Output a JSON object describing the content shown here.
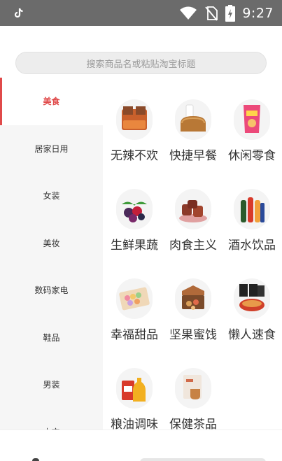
{
  "status_bar": {
    "time": "9:27",
    "app_icon": "tiktok-icon",
    "icons": [
      "wifi-icon",
      "no-sim-icon",
      "battery-charging-icon"
    ]
  },
  "search": {
    "placeholder": "搜索商品名或粘贴淘宝标题"
  },
  "sidebar": {
    "items": [
      {
        "label": "美食",
        "active": true
      },
      {
        "label": "居家日用",
        "active": false
      },
      {
        "label": "女装",
        "active": false
      },
      {
        "label": "美妆",
        "active": false
      },
      {
        "label": "数码家电",
        "active": false
      },
      {
        "label": "鞋品",
        "active": false
      },
      {
        "label": "男装",
        "active": false
      },
      {
        "label": "内衣",
        "active": false
      }
    ]
  },
  "categories": [
    {
      "label": "无辣不欢",
      "icon": "spicy-snack-icon"
    },
    {
      "label": "快捷早餐",
      "icon": "bread-milk-icon"
    },
    {
      "label": "休闲零食",
      "icon": "chips-bag-icon"
    },
    {
      "label": "生鲜果蔬",
      "icon": "fruit-icon"
    },
    {
      "label": "肉食主义",
      "icon": "meat-icon"
    },
    {
      "label": "酒水饮品",
      "icon": "drinks-icon"
    },
    {
      "label": "幸福甜品",
      "icon": "macaron-box-icon"
    },
    {
      "label": "坚果蜜饯",
      "icon": "nuts-box-icon"
    },
    {
      "label": "懒人速食",
      "icon": "instant-noodle-icon"
    },
    {
      "label": "粮油调味",
      "icon": "oil-rice-icon"
    },
    {
      "label": "保健茶品",
      "icon": "tea-icon"
    }
  ],
  "colors": {
    "accent": "#e04a4a",
    "status_bar": "#6b6b6b",
    "sidebar_bg": "#f6f6f6"
  }
}
